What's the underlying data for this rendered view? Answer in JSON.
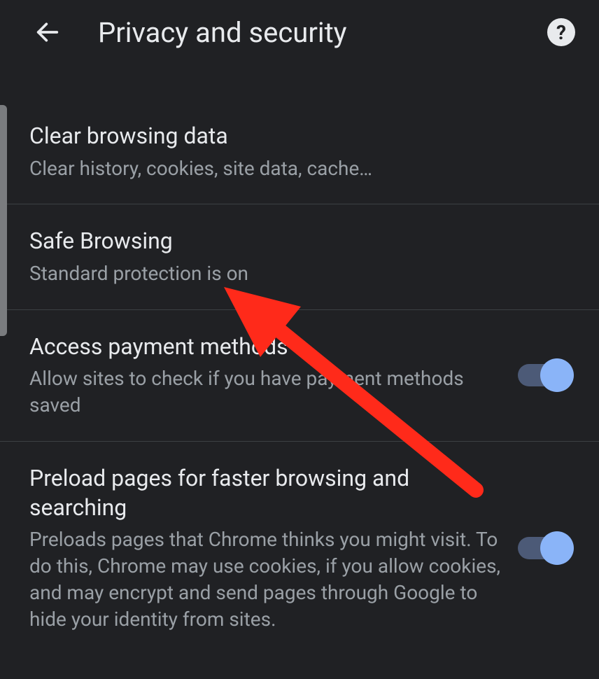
{
  "header": {
    "title": "Privacy and security"
  },
  "items": [
    {
      "title": "Clear browsing data",
      "subtitle": "Clear history, cookies, site data, cache…",
      "toggle": false
    },
    {
      "title": "Safe Browsing",
      "subtitle": "Standard protection is on",
      "toggle": false
    },
    {
      "title": "Access payment methods",
      "subtitle": "Allow sites to check if you have payment methods saved",
      "toggle": true
    },
    {
      "title": "Preload pages for faster browsing and searching",
      "subtitle": "Preloads pages that Chrome thinks you might visit. To do this, Chrome may use cookies, if you allow cookies, and may encrypt and send pages through Google to hide your identity from sites.",
      "toggle": true
    }
  ]
}
